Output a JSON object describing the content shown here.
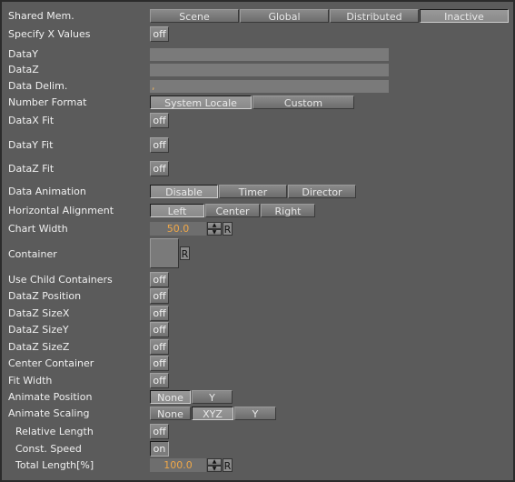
{
  "rows": [
    {
      "label": "Shared Mem.",
      "type": "seg",
      "options": [
        "Scene",
        "Global",
        "Distributed",
        "Inactive"
      ],
      "selected": "Inactive"
    },
    {
      "label": "Specify X Values",
      "type": "toggle",
      "value": "off"
    },
    {
      "label": "DataY",
      "type": "text",
      "value": ""
    },
    {
      "label": "DataZ",
      "type": "text",
      "value": ""
    },
    {
      "label": "Data Delim.",
      "type": "text",
      "value": ","
    },
    {
      "label": "Number Format",
      "type": "seg",
      "options": [
        "System Locale",
        "Custom"
      ],
      "selected": "System Locale"
    },
    {
      "label": "DataX Fit",
      "type": "toggle",
      "value": "off"
    },
    {
      "label": "DataY Fit",
      "type": "toggle",
      "value": "off"
    },
    {
      "label": "DataZ Fit",
      "type": "toggle",
      "value": "off"
    },
    {
      "label": "Data Animation",
      "type": "seg",
      "options": [
        "Disable",
        "Timer",
        "Director"
      ],
      "selected": "Disable"
    },
    {
      "label": "Horizontal Alignment",
      "type": "seg",
      "options": [
        "Left",
        "Center",
        "Right"
      ],
      "selected": "Left"
    },
    {
      "label": "Chart Width",
      "type": "number",
      "value": "50.0",
      "reset": "R"
    },
    {
      "label": "Container",
      "type": "container",
      "reset": "R"
    },
    {
      "label": "Use Child Containers",
      "type": "toggle",
      "value": "off"
    },
    {
      "label": "DataZ Position",
      "type": "toggle",
      "value": "off"
    },
    {
      "label": "DataZ SizeX",
      "type": "toggle",
      "value": "off"
    },
    {
      "label": "DataZ SizeY",
      "type": "toggle",
      "value": "off"
    },
    {
      "label": "DataZ SizeZ",
      "type": "toggle",
      "value": "off"
    },
    {
      "label": "Center Container",
      "type": "toggle",
      "value": "off"
    },
    {
      "label": "Fit Width",
      "type": "toggle",
      "value": "off"
    },
    {
      "label": "Animate Position",
      "type": "seg",
      "options": [
        "None",
        "Y"
      ],
      "selected": "None"
    },
    {
      "label": "Animate Scaling",
      "type": "seg",
      "options": [
        "None",
        "XYZ",
        "Y"
      ],
      "selected": "XYZ"
    },
    {
      "label": "Relative Length",
      "type": "toggle",
      "value": "off",
      "indent": true
    },
    {
      "label": "Const. Speed",
      "type": "toggle",
      "value": "on",
      "indent": true
    },
    {
      "label": "Total Length[%]",
      "type": "number",
      "value": "100.0",
      "reset": "R",
      "indent": true
    }
  ],
  "colors": {
    "panel": "#5b5b5b",
    "value_text": "#f0a848"
  }
}
